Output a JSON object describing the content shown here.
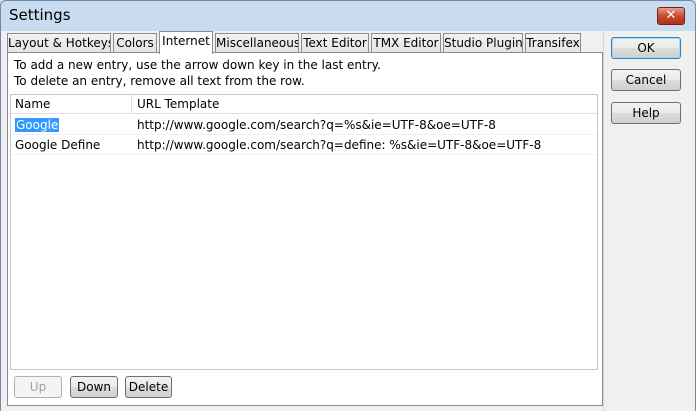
{
  "window": {
    "title": "Settings",
    "close_glyph": "✕"
  },
  "tabs": [
    {
      "label": "Layout & Hotkeys",
      "active": false
    },
    {
      "label": "Colors",
      "active": false
    },
    {
      "label": "Internet",
      "active": true
    },
    {
      "label": "Miscellaneous",
      "active": false
    },
    {
      "label": "Text Editor",
      "active": false
    },
    {
      "label": "TMX Editor",
      "active": false
    },
    {
      "label": "Studio Plugin",
      "active": false
    },
    {
      "label": "Transifex",
      "active": false
    }
  ],
  "info": {
    "line1": "To add a new entry, use the arrow down key in the last entry.",
    "line2": "To delete an entry, remove all text from the row."
  },
  "table": {
    "headers": {
      "name": "Name",
      "url": "URL Template"
    },
    "rows": [
      {
        "name": "Google",
        "url": "http://www.google.com/search?q=%s&ie=UTF-8&oe=UTF-8",
        "selected": true
      },
      {
        "name": "Google Define",
        "url": "http://www.google.com/search?q=define: %s&ie=UTF-8&oe=UTF-8",
        "selected": false
      }
    ]
  },
  "panel_buttons": {
    "up": {
      "label": "Up",
      "enabled": false
    },
    "down": {
      "label": "Down",
      "enabled": true
    },
    "delete": {
      "label": "Delete",
      "enabled": true
    }
  },
  "dialog_buttons": {
    "ok": "OK",
    "cancel": "Cancel",
    "help": "Help"
  }
}
